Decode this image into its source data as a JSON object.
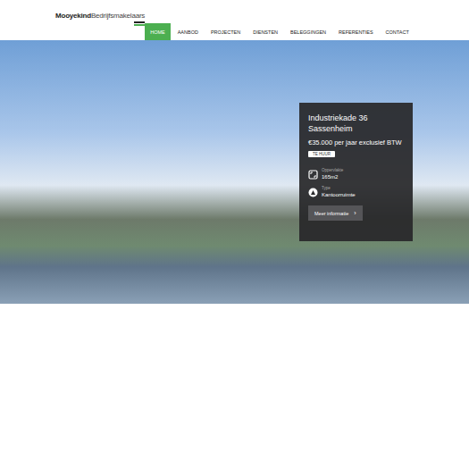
{
  "logo": {
    "bold": "Mooyekind",
    "light": "Bedrijfsmakelaars"
  },
  "nav": [
    {
      "label": "HOME",
      "selected": true
    },
    {
      "label": "AANBOD",
      "selected": false
    },
    {
      "label": "PROJECTEN",
      "selected": false
    },
    {
      "label": "DIENSTEN",
      "selected": false
    },
    {
      "label": "BELEGGINGEN",
      "selected": false
    },
    {
      "label": "REFERENTIES",
      "selected": false
    },
    {
      "label": "CONTACT",
      "selected": false
    }
  ],
  "listing": {
    "title": "Industriekade 36",
    "city": "Sassenheim",
    "price": "€35.000 per jaar exclusief BTW",
    "badge": "TE HUUR",
    "specs": [
      {
        "kind": "area",
        "label": "Oppervlakte",
        "value": "165m2"
      },
      {
        "kind": "type",
        "label": "Type",
        "value": "Kantoorruimte"
      }
    ],
    "button": {
      "label": "Meer informatie",
      "icon": "›"
    }
  }
}
